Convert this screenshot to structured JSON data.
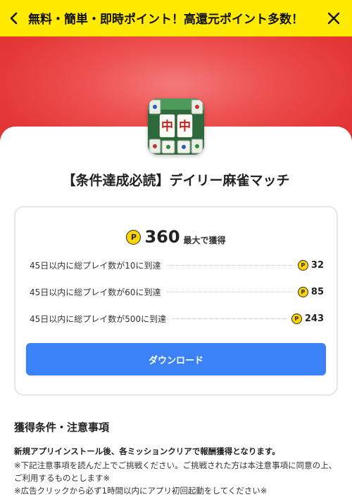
{
  "topbar": {
    "title": "無料・簡単・即時ポイント！高還元ポイント多数！",
    "back_icon": "chevron-left-icon",
    "close_icon": "close-icon"
  },
  "colors": {
    "topbar_bg": "#ffea00",
    "hero_red": "#e53a3a",
    "button_blue": "#3b82f6",
    "coin_yellow": "#ffd400"
  },
  "app": {
    "icon": "mahjong-app-icon",
    "icon_tile_text": "中",
    "title": "【条件達成必読】デイリー麻雀マッチ"
  },
  "reward": {
    "coin_label": "P",
    "total": "360",
    "total_suffix": "最大で獲得",
    "conditions": [
      {
        "label": "45日以内に総プレイ数が10に到達",
        "points": "32"
      },
      {
        "label": "45日以内に総プレイ数が60に到達",
        "points": "85"
      },
      {
        "label": "45日以内に総プレイ数が500に到達",
        "points": "243"
      }
    ],
    "download_label": "ダウンロード"
  },
  "notes": {
    "section_title": "獲得条件・注意事項",
    "lead": "新規アプリインストール後、各ミッションクリアで報酬獲得となります。",
    "line1": "※下記注意事項を読んだ上でご挑戦ください。ご挑戦された方は本注意事項に同意の上、ご利用するものとします※",
    "line2": "※広告クリックから必ず1時間以内にアプリ初回起動をしてください※"
  }
}
